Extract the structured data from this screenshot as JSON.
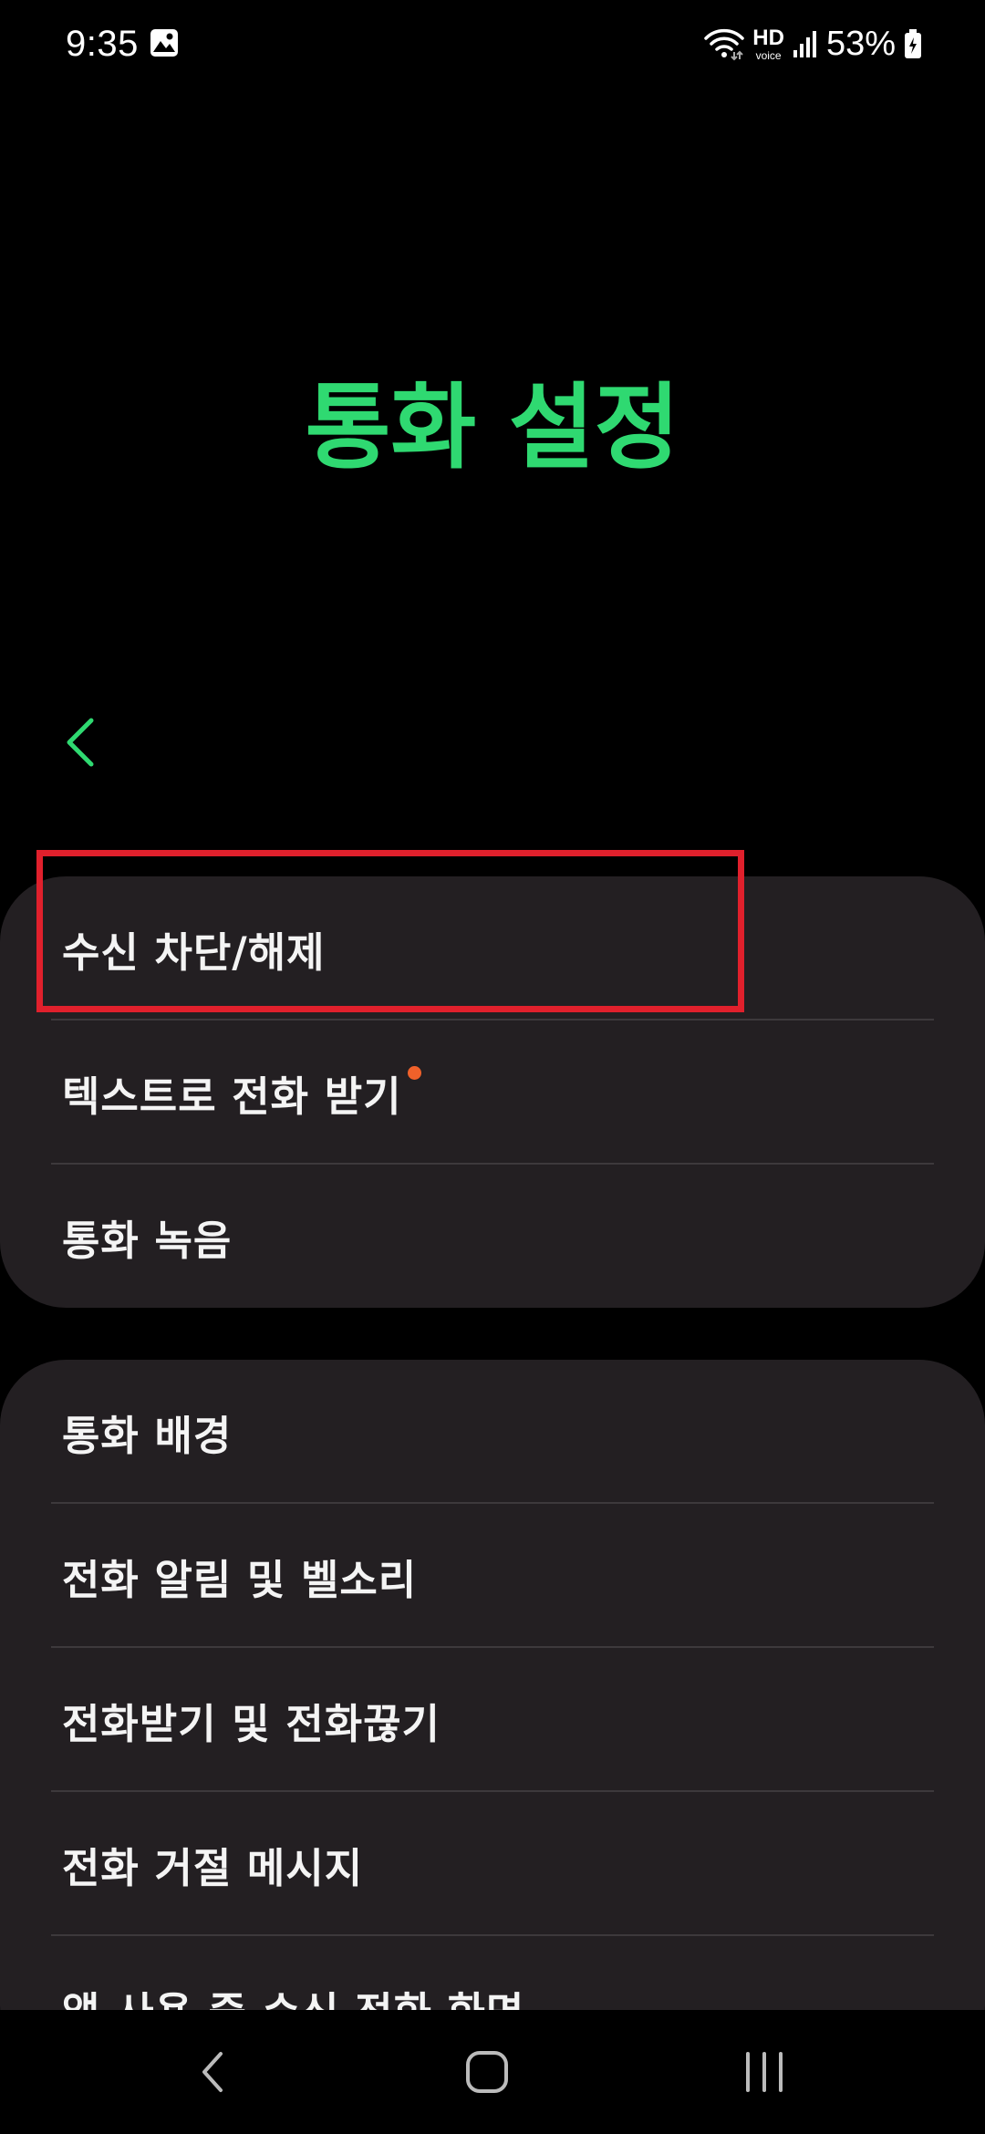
{
  "status_bar": {
    "time": "9:35",
    "icons": [
      "image-notification-icon",
      "wifi-icon",
      "hd-voice-icon",
      "signal-icon",
      "battery-charging-icon"
    ],
    "hd_label": "HD",
    "voice_label": "voice",
    "battery": "53%"
  },
  "header": {
    "title": "통화 설정",
    "title_color": "#2fd971",
    "back_icon": "chevron-left-icon"
  },
  "group1": {
    "items": [
      {
        "label": "수신 차단/해제"
      },
      {
        "label": "텍스트로 전화 받기",
        "badge": "new-dot"
      },
      {
        "label": "통화 녹음"
      }
    ]
  },
  "group2": {
    "items": [
      {
        "label": "통화 배경"
      },
      {
        "label": "전화 알림 및 벨소리"
      },
      {
        "label": "전화받기 및 전화끊기"
      },
      {
        "label": "전화 거절 메시지"
      },
      {
        "label": "앱 사용 중 수신 전화 화면"
      }
    ]
  },
  "highlight_color": "#e0202c",
  "nav_bar": {
    "icons": [
      "back-icon",
      "home-icon",
      "recents-icon"
    ]
  }
}
